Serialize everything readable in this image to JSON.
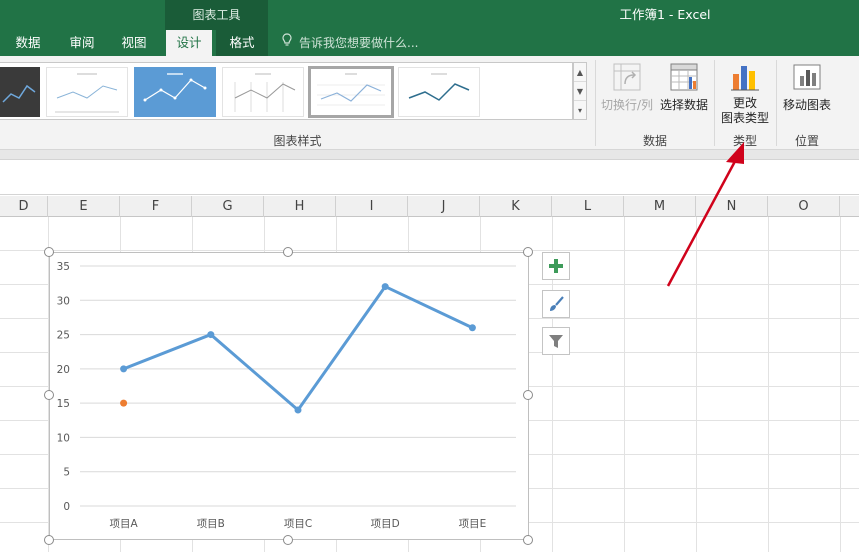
{
  "titlebar": {
    "context_header": "图表工具",
    "window_title": "工作簿1 - Excel",
    "tabs": [
      {
        "label": "数据"
      },
      {
        "label": "审阅"
      },
      {
        "label": "视图"
      },
      {
        "label": "设计"
      },
      {
        "label": "格式"
      }
    ],
    "active_tab": "设计",
    "tell_me": "告诉我您想要做什么..."
  },
  "ribbon": {
    "groups": {
      "chart_styles": "图表样式",
      "data": "数据",
      "type": "类型",
      "location": "位置"
    },
    "buttons": {
      "switch_row_col": "切换行/列",
      "select_data": "选择数据",
      "change_type_line1": "更改",
      "change_type_line2": "图表类型",
      "move_chart": "移动图表"
    }
  },
  "columns": [
    "D",
    "E",
    "F",
    "G",
    "H",
    "I",
    "J",
    "K",
    "L",
    "M",
    "N",
    "O"
  ],
  "chart_data": {
    "type": "line",
    "categories": [
      "项目A",
      "项目B",
      "项目C",
      "项目D",
      "项目E"
    ],
    "series": [
      {
        "values": [
          20,
          25,
          14,
          32,
          26
        ],
        "color": "#5b9bd5"
      },
      {
        "values": [
          15,
          null,
          null,
          null,
          null
        ],
        "color": "#ed7d31"
      }
    ],
    "ylim": [
      0,
      35
    ],
    "yticks": [
      0,
      5,
      10,
      15,
      20,
      25,
      30,
      35
    ],
    "grid": true
  },
  "colors": {
    "excel_green": "#217346",
    "accent_blue": "#5b9bd5",
    "accent_orange": "#ed7d31",
    "annotation_arrow": "#d0021b"
  },
  "icons": {
    "chart_elements": "plus-icon",
    "chart_styles": "brush-icon",
    "chart_filters": "funnel-icon"
  }
}
